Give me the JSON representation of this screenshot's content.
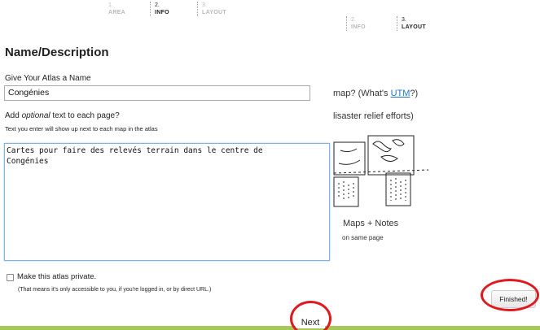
{
  "wizard_steps_top": [
    {
      "num": "1.",
      "label": "AREA",
      "state": "dim"
    },
    {
      "num": "2.",
      "label": "INFO",
      "state": "active"
    },
    {
      "num": "3.",
      "label": "LAYOUT",
      "state": "dim"
    }
  ],
  "wizard_steps_right": [
    {
      "num": "2.",
      "label": "INFO",
      "state": "dim"
    },
    {
      "num": "3.",
      "label": "LAYOUT",
      "state": "active"
    }
  ],
  "background": {
    "utm_prefix": "map? (What's ",
    "utm_link": "UTM",
    "utm_suffix": "?)",
    "relief_text": "lisaster relief efforts)",
    "maps_notes_title": "Maps + Notes",
    "maps_notes_sub": "on same page"
  },
  "form": {
    "title": "Name/Description",
    "name_label": "Give Your Atlas a Name",
    "name_value": "Congénies",
    "text_label_pre": "Add ",
    "text_label_em": "optional",
    "text_label_post": " text to each page?",
    "text_hint": "Text you enter will show up next to each map in the atlas",
    "text_value": "Cartes pour faire des relevés terrain dans le centre de\nCongénies",
    "private_label": "Make this atlas private.",
    "private_note": "(That means it's only accessible to you, if you're logged in, or by direct URL.)"
  },
  "buttons": {
    "finished": "Finished!",
    "next": "Next"
  },
  "colors": {
    "annotation_ring": "#e0191f",
    "link": "#1a73c9",
    "bottom_bar": "#a6c95a",
    "focus_border": "#7fb2e5"
  }
}
